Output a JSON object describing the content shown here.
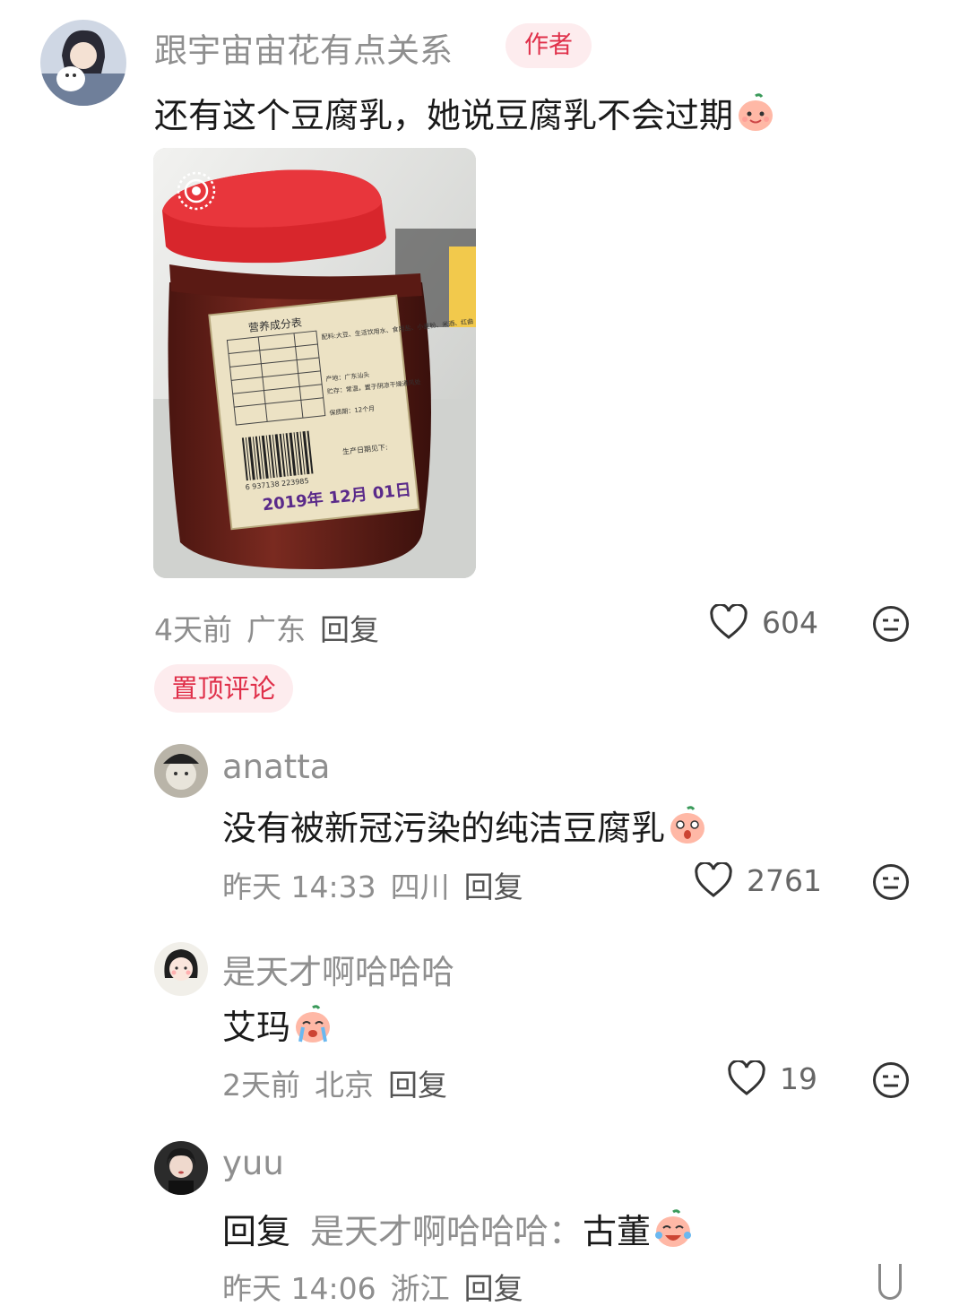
{
  "main_comment": {
    "author": "跟宇宙宙花有点关系",
    "badge": "作者",
    "text": "还有这个豆腐乳，她说豆腐乳不会过期",
    "time": "4天前",
    "location": "广东",
    "reply_label": "回复",
    "likes": "604",
    "photo_label": {
      "title": "营养成分表",
      "ingredients": "配料:大豆、生活饮用水、食用盐、小麦粉、米酒、红曲",
      "origin": "产地：广东汕头",
      "storage": "贮存：常温，置于阴凉干燥通风处",
      "shelf_life": "保质期：12个月",
      "barcode": "6 937138 223985",
      "date_caption": "生产日期见下:",
      "date": "2019年 12月 01日"
    }
  },
  "pinned_badge": "置顶评论",
  "replies": [
    {
      "author": "anatta",
      "text": "没有被新冠污染的纯洁豆腐乳",
      "time": "昨天 14:33",
      "location": "四川",
      "reply_label": "回复",
      "likes": "2761"
    },
    {
      "author": "是天才啊哈哈哈",
      "text": "艾玛",
      "time": "2天前",
      "location": "北京",
      "reply_label": "回复",
      "likes": "19"
    },
    {
      "author": "yuu",
      "reply_prefix": "回复",
      "reply_to": "是天才啊哈哈哈：",
      "text": "古董",
      "time": "昨天 14:06",
      "location": "浙江",
      "reply_label": "回复"
    }
  ],
  "icons": {
    "like": "heart-icon",
    "dislike": "unamused-face-icon",
    "live_photo": "live-photo-icon"
  },
  "colors": {
    "accent": "#e0304a",
    "badge_bg": "#fdecee",
    "meta": "#8e8e8e"
  }
}
